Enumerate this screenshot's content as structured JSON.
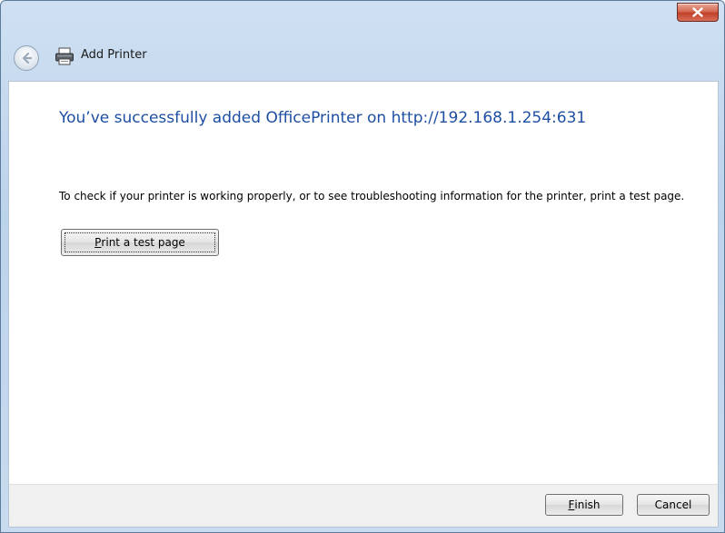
{
  "window": {
    "title": "Add Printer"
  },
  "main": {
    "headline": "You’ve successfully added OfficePrinter on http://192.168.1.254:631",
    "description": "To check if your printer is working properly, or to see troubleshooting information for the printer, print a test page.",
    "test_page_button": {
      "mnemonic": "P",
      "rest": "rint a test page"
    }
  },
  "footer": {
    "finish_button": {
      "mnemonic": "F",
      "rest": "inish"
    },
    "cancel_label": "Cancel"
  },
  "icons": {
    "close": "close-icon",
    "back": "back-arrow-icon",
    "printer": "printer-icon"
  },
  "colors": {
    "headline": "#1e4fa3",
    "close_button": "#c2402a",
    "window_chrome": "#bcd3ec"
  }
}
